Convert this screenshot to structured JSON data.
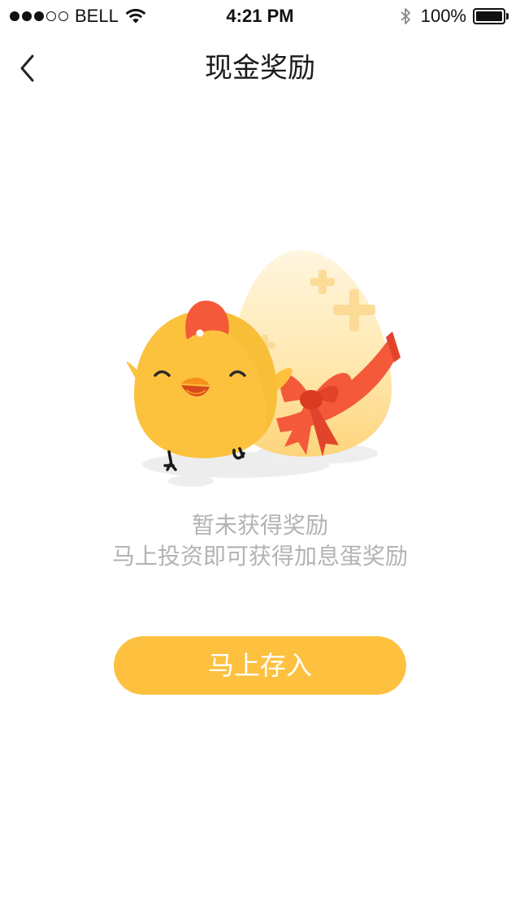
{
  "status_bar": {
    "signal_bars_filled": 3,
    "signal_bars_total": 5,
    "carrier": "BELL",
    "time": "4:21 PM",
    "battery_percent": "100%",
    "icons": [
      "wifi-icon",
      "bluetooth-icon",
      "battery-icon"
    ]
  },
  "nav": {
    "title": "现金奖励",
    "back_icon": "chevron-left-icon"
  },
  "empty_state": {
    "line1": "暂未获得奖励",
    "line2": "马上投资即可获得加息蛋奖励"
  },
  "cta": {
    "label": "马上存入"
  },
  "colors": {
    "accent": "#fdc13f",
    "chick": "#fcc23e",
    "ribbon": "#f4593a",
    "muted_text": "#b3b3b3"
  }
}
